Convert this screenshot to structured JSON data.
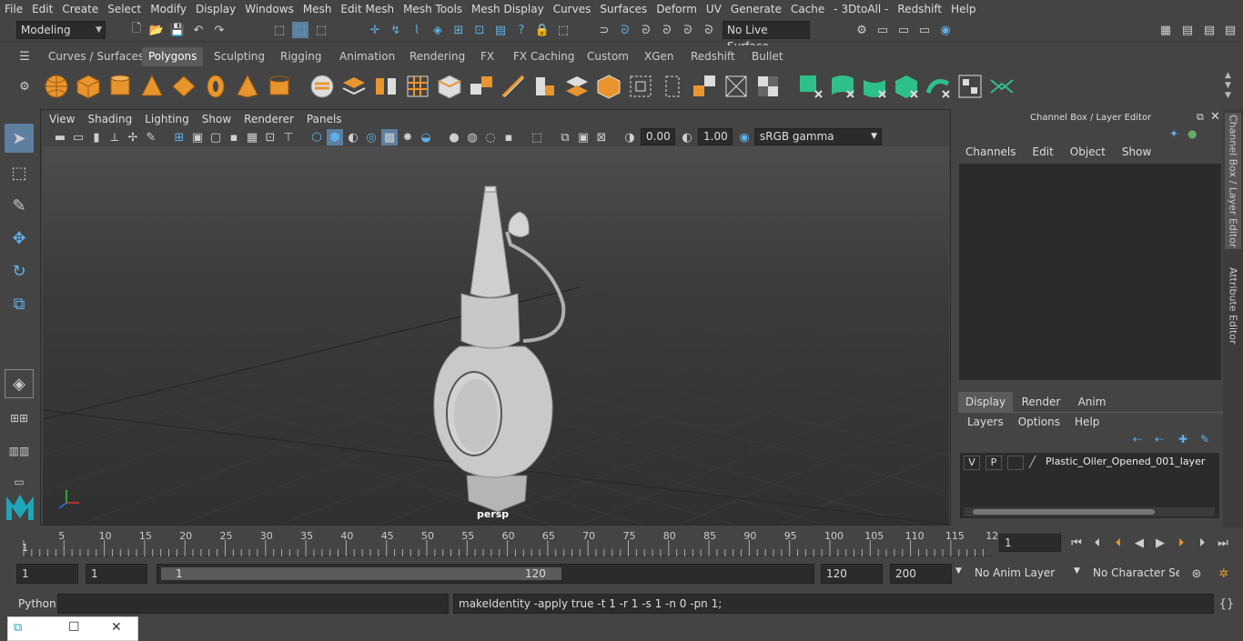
{
  "menubar": {
    "items": [
      "File",
      "Edit",
      "Create",
      "Select",
      "Modify",
      "Display",
      "Windows",
      "Mesh",
      "Edit Mesh",
      "Mesh Tools",
      "Mesh Display",
      "Curves",
      "Surfaces",
      "Deform",
      "UV",
      "Generate",
      "Cache",
      "- 3DtoAll -",
      "Redshift",
      "Help"
    ]
  },
  "status": {
    "mode": "Modeling",
    "live_surface": "No Live Surface"
  },
  "shelf": {
    "tabs": [
      "Curves / Surfaces",
      "Polygons",
      "Sculpting",
      "Rigging",
      "Animation",
      "Rendering",
      "FX",
      "FX Caching",
      "Custom",
      "XGen",
      "Redshift",
      "Bullet"
    ],
    "active": "Polygons",
    "primitive_color": "#e8952e",
    "green_color": "#2fbf8a"
  },
  "viewport": {
    "menu": [
      "View",
      "Shading",
      "Lighting",
      "Show",
      "Renderer",
      "Panels"
    ],
    "exposure": "0.00",
    "gamma": "1.00",
    "color_space": "sRGB gamma",
    "camera": "persp"
  },
  "channelbox": {
    "title": "Channel Box / Layer Editor",
    "menu": [
      "Channels",
      "Edit",
      "Object",
      "Show"
    ]
  },
  "layers": {
    "tabs": [
      "Display",
      "Render",
      "Anim"
    ],
    "active": "Display",
    "menu": [
      "Layers",
      "Options",
      "Help"
    ],
    "row": {
      "v": "V",
      "p": "P",
      "name": "Plastic_Oiler_Opened_001_layer"
    }
  },
  "sidetabs": {
    "channel": "Channel Box / Layer Editor",
    "attr": "Attribute Editor"
  },
  "timeline": {
    "ticks": [
      "5",
      "10",
      "15",
      "20",
      "25",
      "30",
      "35",
      "40",
      "45",
      "50",
      "55",
      "60",
      "65",
      "70",
      "75",
      "80",
      "85",
      "90",
      "95",
      "100",
      "105",
      "110",
      "115",
      "12"
    ],
    "start_label": "1",
    "current_frame": "1"
  },
  "range": {
    "start": "1",
    "playback_start": "1",
    "slider_start": "1",
    "slider_end": "120",
    "end": "120",
    "anim_end": "200",
    "anim_layer": "No Anim Layer",
    "char_set": "No Character Set"
  },
  "cmd": {
    "lang": "Python",
    "output": "makeIdentity -apply true -t 1 -r 1 -s 1 -n 0 -pn 1;"
  },
  "icons": {
    "min": "minimize-icon",
    "max": "maximize-icon",
    "close": "close-icon"
  }
}
